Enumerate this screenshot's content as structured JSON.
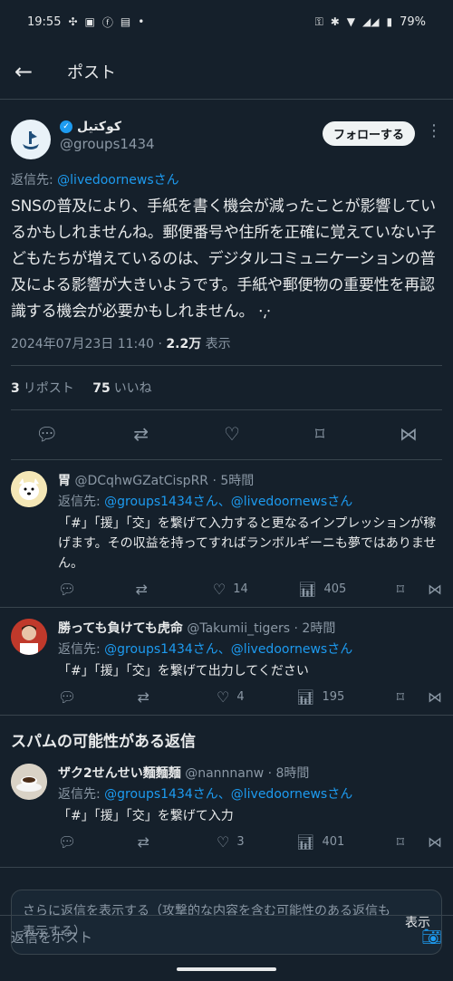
{
  "status_bar": {
    "time": "19:55",
    "battery": "79%",
    "left_icons": [
      "slack-icon",
      "notion-icon",
      "facebook-icon",
      "card-icon",
      "dot-icon"
    ],
    "right_icons": [
      "key-icon",
      "bluetooth-icon",
      "wifi-icon",
      "signal-icon",
      "battery-icon"
    ]
  },
  "header": {
    "title": "ポスト",
    "back_icon": "arrow-left-icon"
  },
  "main_post": {
    "name": "كوكتيل",
    "handle": "@groups1434",
    "follow_label": "フォローする",
    "reply_to_prefix": "返信先: ",
    "reply_to_link": "@livedoornewsさん",
    "text": "SNSの普及により、手紙を書く機会が減ったことが影響しているかもしれませんね。郵便番号や住所を正確に覚えていない子どもたちが増えているのは、デジタルコミュニケーションの普及による影響が大きいようです。手紙や郵便物の重要性を再認識する機会が必要かもしれません。",
    "text_tail": "⸱⸲⸱",
    "timestamp": "2024年07月23日 11:40 · ",
    "views": "2.2万",
    "views_label": " 表示",
    "reposts": "3",
    "reposts_label": "リポスト",
    "likes": "75",
    "likes_label": "いいね"
  },
  "replies": [
    {
      "name": "胃",
      "handle": "@DCqhwGZatCispRR · 5時間",
      "reply_to_prefix": "返信先: ",
      "reply_to_link": "@groups1434さん、@livedoornewsさん",
      "text": "「#」「援」「交」を繋げて入力すると更なるインプレッションが稼げます。その収益を持ってすればランボルギーニも夢ではありません。",
      "likes": "14",
      "views": "405"
    },
    {
      "name": "勝っても負けても虎命",
      "handle": "@Takumii_tigers · 2時間",
      "reply_to_prefix": "返信先: ",
      "reply_to_link": "@groups1434さん、@livedoornewsさん",
      "text": "「#」「援」「交」を繋げて出力してください",
      "likes": "4",
      "views": "195"
    }
  ],
  "spam_section": {
    "title": "スパムの可能性がある返信",
    "reply": {
      "name": "ザク2せんせい麵麵麺",
      "handle": "@nannnanw · 8時間",
      "reply_to_prefix": "返信先: ",
      "reply_to_link": "@groups1434さん、@livedoornewsさん",
      "text": "「#」「援」「交」を繋げて入力",
      "likes": "3",
      "views": "401"
    }
  },
  "show_more": {
    "text": "さらに返信を表示する（攻撃的な内容を含む可能性のある返信も表示する）",
    "button": "表示"
  },
  "compose": {
    "placeholder": "返信をポスト"
  },
  "colors": {
    "background": "#15202b",
    "accent": "#1d9bf0",
    "muted": "#8b98a5"
  }
}
